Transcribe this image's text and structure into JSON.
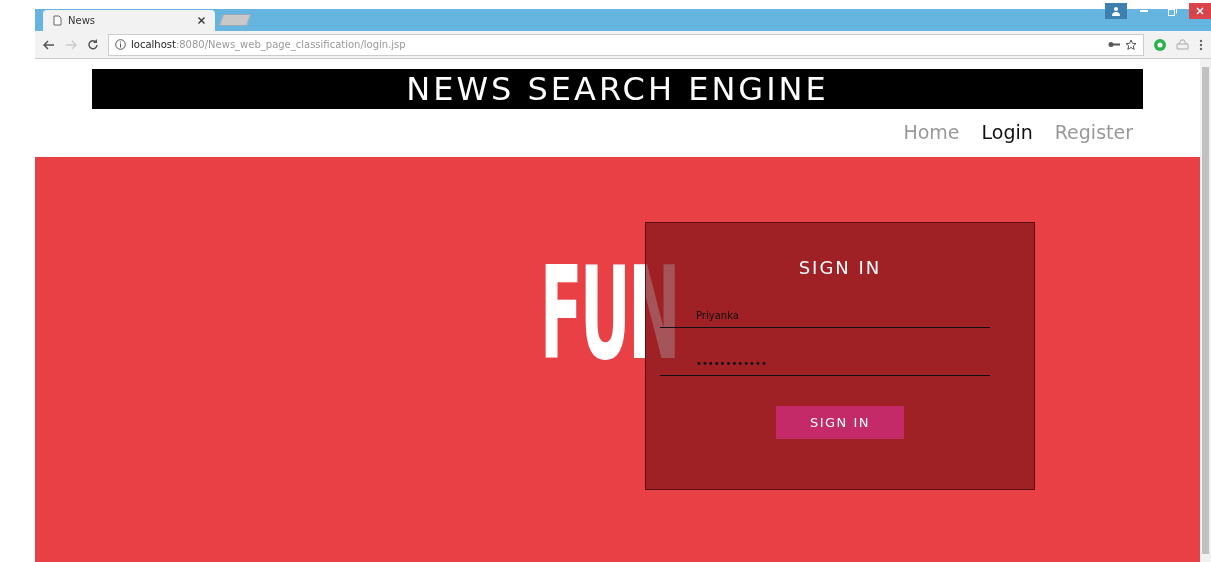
{
  "browser": {
    "tab": {
      "title": "News"
    },
    "url_host": "localhost",
    "url_path": ":8080/News_web_page_classification/login.jsp"
  },
  "header": {
    "title": "NEWS SEARCH ENGINE"
  },
  "nav": [
    {
      "label": "Home",
      "selected": false
    },
    {
      "label": "Login",
      "selected": true
    },
    {
      "label": "Register",
      "selected": false
    }
  ],
  "logo": {
    "text": "FUN"
  },
  "login": {
    "title": "SIGN IN",
    "username": "Priyanka",
    "password": "••••••••••••",
    "button": "SIGN IN"
  }
}
